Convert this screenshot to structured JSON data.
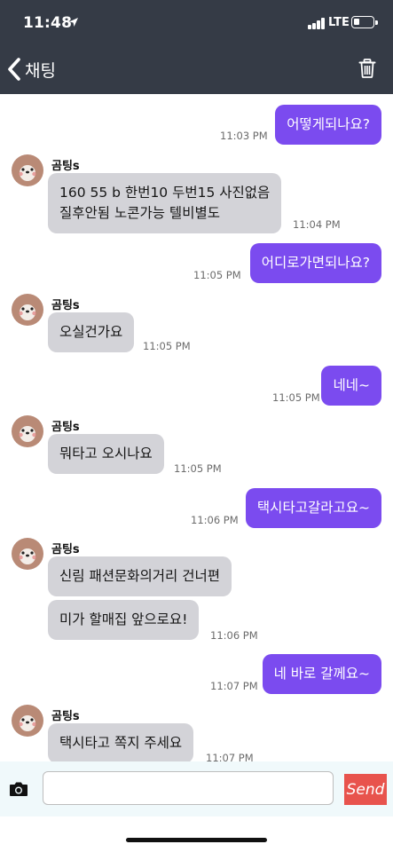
{
  "status_bar": {
    "time": "11:48",
    "network": "LTE"
  },
  "nav": {
    "title": "채팅"
  },
  "messages": [
    {
      "dir": "out",
      "text": "어떻게되나요?",
      "time": "11:03 PM"
    },
    {
      "dir": "in",
      "sender": "곰팅s",
      "text": "160 55 b 한번10 두번15 사진없음\n질후안됨 노콘가능 텔비별도",
      "time": "11:04 PM"
    },
    {
      "dir": "out",
      "text": "어디로가면되나요?",
      "time": "11:05 PM"
    },
    {
      "dir": "in",
      "sender": "곰팅s",
      "text": "오실건가요",
      "time": "11:05 PM"
    },
    {
      "dir": "out",
      "text": "네네~",
      "time": "11:05 PM"
    },
    {
      "dir": "in",
      "sender": "곰팅s",
      "text": "뭐타고 오시나요",
      "time": "11:05 PM"
    },
    {
      "dir": "out",
      "text": "택시타고갈라고요~",
      "time": "11:06 PM"
    },
    {
      "dir": "in",
      "sender": "곰팅s",
      "text": "신림 패션문화의거리 건너편",
      "time": ""
    },
    {
      "dir": "in",
      "text": "미가 할매집 앞으로요!",
      "time": "11:06 PM"
    },
    {
      "dir": "out",
      "text": "네 바로 갈께요~",
      "time": "11:07 PM"
    },
    {
      "dir": "in",
      "sender": "곰팅s",
      "text": "택시타고 쪽지 주세요",
      "time": "11:07 PM"
    }
  ],
  "composer": {
    "placeholder": "",
    "send_label": "Send"
  },
  "colors": {
    "header": "#353b46",
    "outgoing": "#7b4bef",
    "incoming": "#d3d3d8",
    "send": "#e8534d"
  }
}
